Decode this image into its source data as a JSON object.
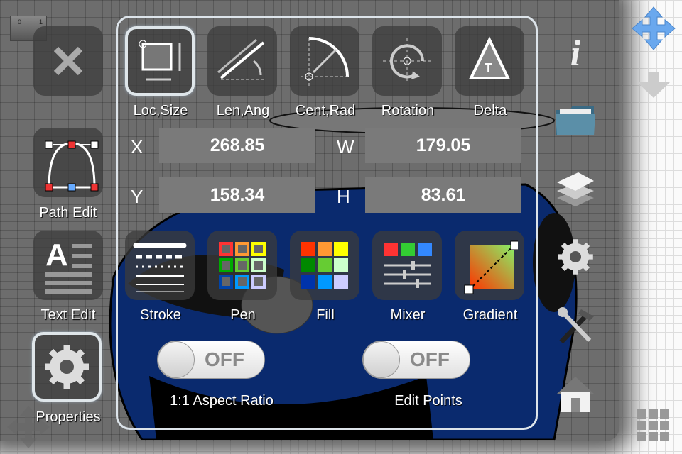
{
  "left_tools": {
    "close_icon": "close-icon",
    "path_edit": "Path Edit",
    "text_edit": "Text Edit",
    "properties": "Properties"
  },
  "ruler": {
    "tick0": "0",
    "tick1": "1"
  },
  "modes": [
    {
      "label": "Loc,Size",
      "selected": true
    },
    {
      "label": "Len,Ang"
    },
    {
      "label": "Cent,Rad"
    },
    {
      "label": "Rotation"
    },
    {
      "label": "Delta"
    }
  ],
  "fields": {
    "x_label": "X",
    "x_value": "268.85",
    "w_label": "W",
    "w_value": "179.05",
    "y_label": "Y",
    "y_value": "158.34",
    "h_label": "H",
    "h_value": "83.61"
  },
  "style_tools": [
    {
      "label": "Stroke"
    },
    {
      "label": "Pen"
    },
    {
      "label": "Fill"
    },
    {
      "label": "Mixer"
    },
    {
      "label": "Gradient"
    }
  ],
  "toggles": [
    {
      "label": "1:1 Aspect Ratio",
      "state": "OFF"
    },
    {
      "label": "Edit Points",
      "state": "OFF"
    }
  ],
  "delta_glyph": "T",
  "colors": {
    "accent_blue": "#5a9ae8",
    "car_blue": "#0a2a6e",
    "panel_border": "#dde4ea"
  },
  "right_tools": [
    "info-icon",
    "folder-icon",
    "layers-icon",
    "gear-icon",
    "tools-icon",
    "home-icon"
  ],
  "far_right": [
    "move-arrows-icon",
    "arrow-down-icon",
    "grid-icon"
  ],
  "info_glyph": "i"
}
